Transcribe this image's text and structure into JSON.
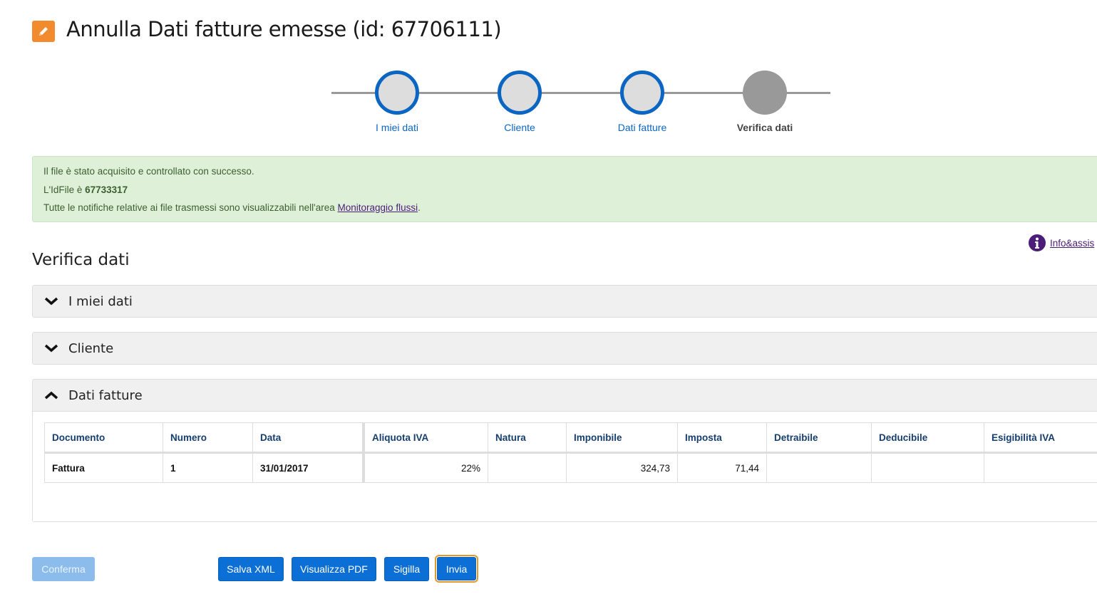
{
  "header": {
    "title": "Annulla Dati fatture emesse (id: 67706111)",
    "icon": "pencil-icon",
    "icon_color": "#f28a2e"
  },
  "stepper": {
    "steps": [
      {
        "label": "I miei dati",
        "state": "done"
      },
      {
        "label": "Cliente",
        "state": "done"
      },
      {
        "label": "Dati fatture",
        "state": "done"
      },
      {
        "label": "Verifica dati",
        "state": "current"
      }
    ]
  },
  "alert": {
    "line1": "Il file è stato acquisito e controllato con successo.",
    "line2_prefix": "L'IdFile è ",
    "id_file": "67733317",
    "line3_prefix": "Tutte le notifiche relative ai file trasmessi sono visualizzabili nell'area ",
    "link": "Monitoraggio flussi",
    "line3_suffix": "."
  },
  "info_link": "Info&assis",
  "section_title": "Verifica dati",
  "panels": [
    {
      "label": "I miei dati",
      "expanded": false
    },
    {
      "label": "Cliente",
      "expanded": false
    },
    {
      "label": "Dati fatture",
      "expanded": true
    }
  ],
  "table": {
    "headers": [
      "Documento",
      "Numero",
      "Data",
      "Aliquota IVA",
      "Natura",
      "Imponibile",
      "Imposta",
      "Detraibile",
      "Deducibile",
      "Esigibilità IVA"
    ],
    "rows": [
      [
        "Fattura",
        "1",
        "31/01/2017",
        "22%",
        "",
        "324,73",
        "71,44",
        "",
        "",
        ""
      ]
    ]
  },
  "buttons": {
    "conferma": "Conferma",
    "salva_xml": "Salva XML",
    "visualizza_pdf": "Visualizza PDF",
    "sigilla": "Sigilla",
    "invia": "Invia"
  },
  "colors": {
    "primary": "#0b6fd6",
    "success_bg": "#dff0d8",
    "focus": "#e09a2a"
  }
}
